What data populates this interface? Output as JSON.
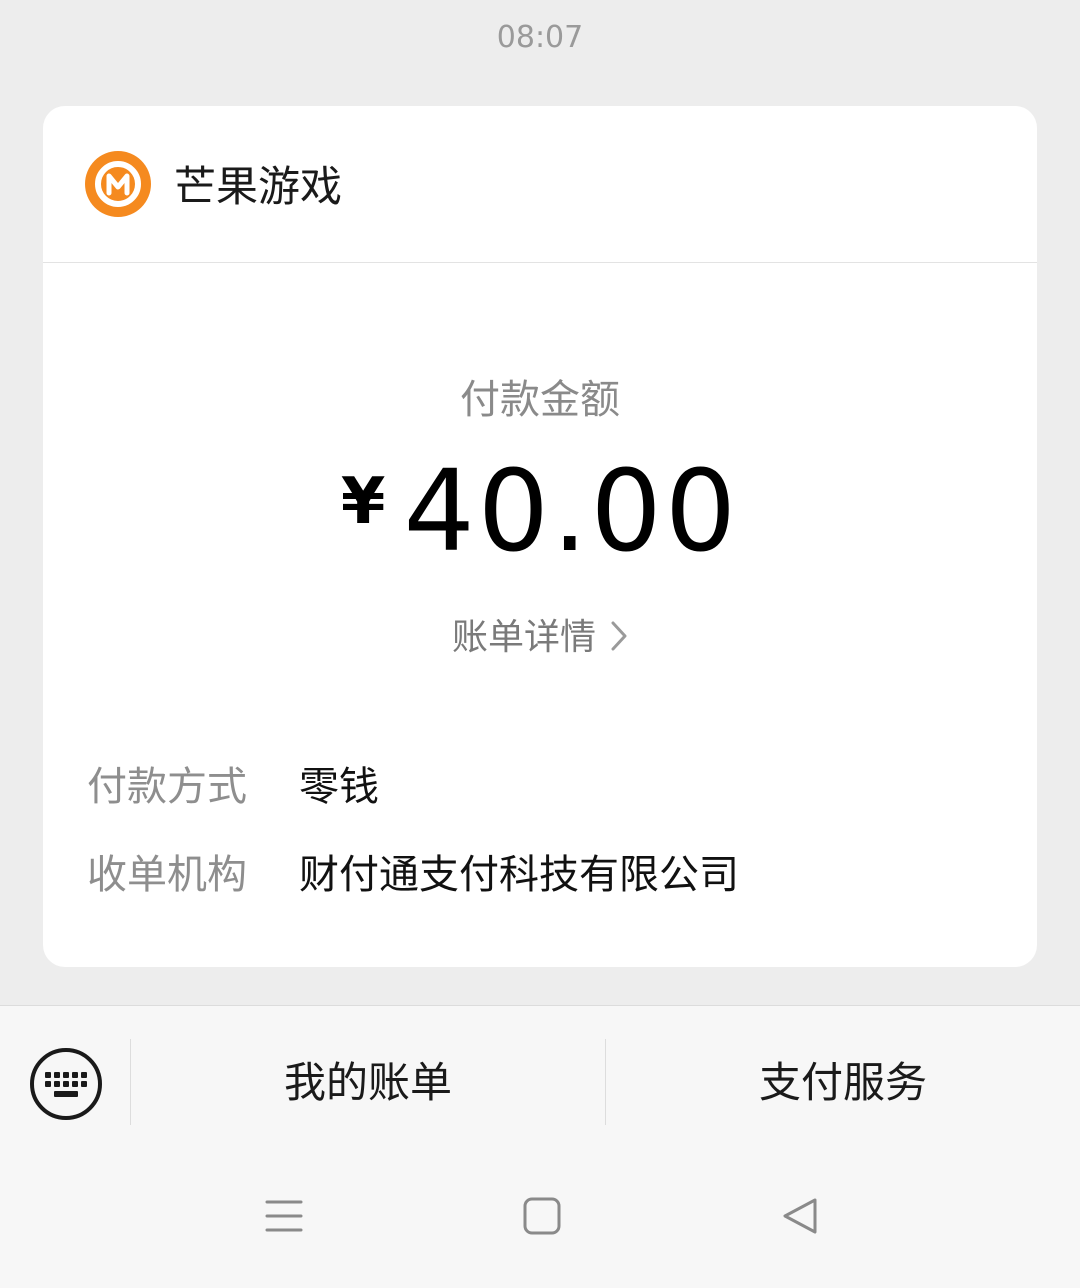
{
  "timestamp": "08:07",
  "card": {
    "merchant_name": "芒果游戏",
    "logo_icon": "mango-tv-logo-icon",
    "logo_color": "#f58a1f",
    "amount_label": "付款金额",
    "currency_symbol": "¥",
    "amount": "40.00",
    "bill_detail_label": "账单详情",
    "details": [
      {
        "label": "付款方式",
        "value": "零钱"
      },
      {
        "label": "收单机构",
        "value": "财付通支付科技有限公司"
      }
    ]
  },
  "bottom_bar": {
    "keyboard_icon": "keyboard-icon",
    "menu_items": [
      {
        "label": "我的账单"
      },
      {
        "label": "支付服务"
      }
    ]
  },
  "nav_bar": {
    "icons": [
      "menu-icon",
      "home-icon",
      "back-icon"
    ]
  }
}
